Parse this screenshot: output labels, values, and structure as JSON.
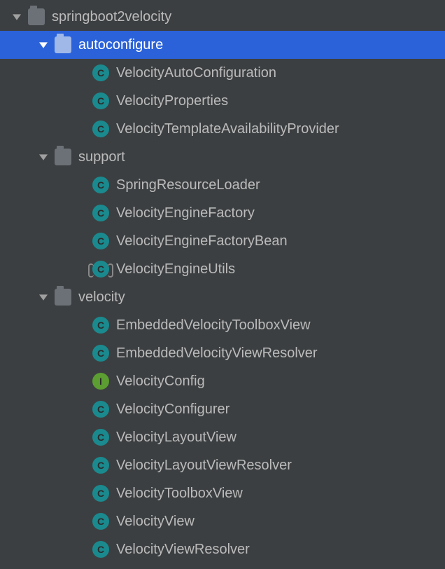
{
  "tree": [
    {
      "depth": 0,
      "expanded": true,
      "kind": "package",
      "label": "springboot2velocity",
      "selected": false,
      "interactable": true
    },
    {
      "depth": 1,
      "expanded": true,
      "kind": "package",
      "label": "autoconfigure",
      "selected": true,
      "interactable": true
    },
    {
      "depth": 2,
      "expanded": null,
      "kind": "class",
      "label": "VelocityAutoConfiguration",
      "selected": false,
      "interactable": true
    },
    {
      "depth": 2,
      "expanded": null,
      "kind": "class",
      "label": "VelocityProperties",
      "selected": false,
      "interactable": true
    },
    {
      "depth": 2,
      "expanded": null,
      "kind": "class",
      "label": "VelocityTemplateAvailabilityProvider",
      "selected": false,
      "interactable": true
    },
    {
      "depth": 1,
      "expanded": true,
      "kind": "package",
      "label": "support",
      "selected": false,
      "interactable": true
    },
    {
      "depth": 2,
      "expanded": null,
      "kind": "class",
      "label": "SpringResourceLoader",
      "selected": false,
      "interactable": true
    },
    {
      "depth": 2,
      "expanded": null,
      "kind": "class",
      "label": "VelocityEngineFactory",
      "selected": false,
      "interactable": true
    },
    {
      "depth": 2,
      "expanded": null,
      "kind": "class",
      "label": "VelocityEngineFactoryBean",
      "selected": false,
      "interactable": true
    },
    {
      "depth": 2,
      "expanded": null,
      "kind": "util",
      "label": "VelocityEngineUtils",
      "selected": false,
      "interactable": true
    },
    {
      "depth": 1,
      "expanded": true,
      "kind": "package",
      "label": "velocity",
      "selected": false,
      "interactable": true
    },
    {
      "depth": 2,
      "expanded": null,
      "kind": "class",
      "label": "EmbeddedVelocityToolboxView",
      "selected": false,
      "interactable": true
    },
    {
      "depth": 2,
      "expanded": null,
      "kind": "class",
      "label": "EmbeddedVelocityViewResolver",
      "selected": false,
      "interactable": true
    },
    {
      "depth": 2,
      "expanded": null,
      "kind": "interface",
      "label": "VelocityConfig",
      "selected": false,
      "interactable": true
    },
    {
      "depth": 2,
      "expanded": null,
      "kind": "class",
      "label": "VelocityConfigurer",
      "selected": false,
      "interactable": true
    },
    {
      "depth": 2,
      "expanded": null,
      "kind": "class",
      "label": "VelocityLayoutView",
      "selected": false,
      "interactable": true
    },
    {
      "depth": 2,
      "expanded": null,
      "kind": "class",
      "label": "VelocityLayoutViewResolver",
      "selected": false,
      "interactable": true
    },
    {
      "depth": 2,
      "expanded": null,
      "kind": "class",
      "label": "VelocityToolboxView",
      "selected": false,
      "interactable": true
    },
    {
      "depth": 2,
      "expanded": null,
      "kind": "class",
      "label": "VelocityView",
      "selected": false,
      "interactable": true
    },
    {
      "depth": 2,
      "expanded": null,
      "kind": "class",
      "label": "VelocityViewResolver",
      "selected": false,
      "interactable": true
    }
  ],
  "indentUnit": 38,
  "baseIndent": 16,
  "leafExtraIndent": 40
}
